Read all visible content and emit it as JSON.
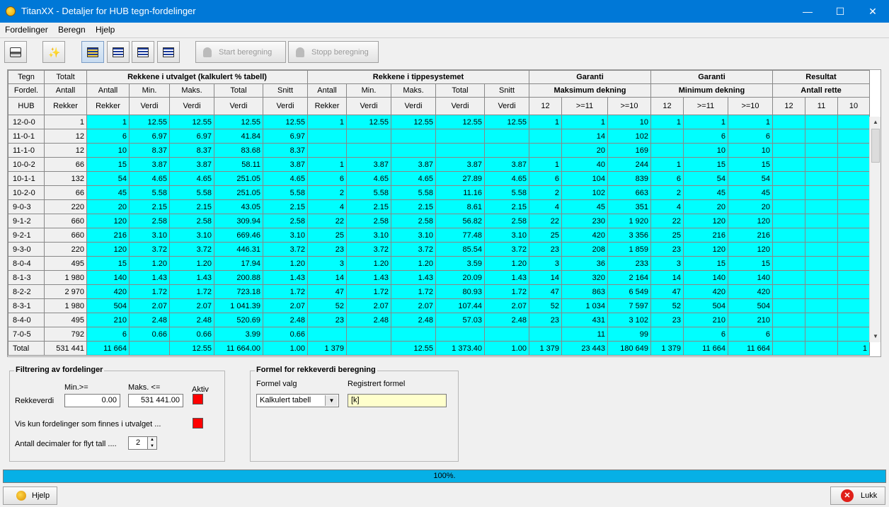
{
  "window": {
    "title": "TitanXX - Detaljer for HUB tegn-fordelinger"
  },
  "menu": [
    "Fordelinger",
    "Beregn",
    "Hjelp"
  ],
  "toolbar": {
    "start_label": "Start beregning",
    "stop_label": "Stopp beregning"
  },
  "grid": {
    "group_headers": [
      "Tegn",
      "Totalt",
      "Rekkene i utvalget (kalkulert % tabell)",
      "Rekkene i tippesystemet",
      "Garanti",
      "Garanti",
      "Resultat"
    ],
    "sub_headers": [
      "Fordel.",
      "Antall",
      "Antall",
      "Min.",
      "Maks.",
      "Total",
      "Snitt",
      "Antall",
      "Min.",
      "Maks.",
      "Total",
      "Snitt",
      "Maksimum dekning",
      "Minimum dekning",
      "Antall rette"
    ],
    "col_headers": [
      "HUB",
      "Rekker",
      "Rekker",
      "Verdi",
      "Verdi",
      "Verdi",
      "Verdi",
      "Rekker",
      "Verdi",
      "Verdi",
      "Verdi",
      "Verdi",
      "12",
      ">=11",
      ">=10",
      "12",
      ">=11",
      ">=10",
      "12",
      "11",
      "10"
    ],
    "rows": [
      [
        "12-0-0",
        "1",
        "1",
        "12.55",
        "12.55",
        "12.55",
        "12.55",
        "1",
        "12.55",
        "12.55",
        "12.55",
        "12.55",
        "1",
        "1",
        "10",
        "1",
        "1",
        "1",
        "",
        "",
        ""
      ],
      [
        "11-0-1",
        "12",
        "6",
        "6.97",
        "6.97",
        "41.84",
        "6.97",
        "",
        "",
        "",
        "",
        "",
        "",
        "14",
        "102",
        "",
        "6",
        "6",
        "",
        "",
        ""
      ],
      [
        "11-1-0",
        "12",
        "10",
        "8.37",
        "8.37",
        "83.68",
        "8.37",
        "",
        "",
        "",
        "",
        "",
        "",
        "20",
        "169",
        "",
        "10",
        "10",
        "",
        "",
        ""
      ],
      [
        "10-0-2",
        "66",
        "15",
        "3.87",
        "3.87",
        "58.11",
        "3.87",
        "1",
        "3.87",
        "3.87",
        "3.87",
        "3.87",
        "1",
        "40",
        "244",
        "1",
        "15",
        "15",
        "",
        "",
        ""
      ],
      [
        "10-1-1",
        "132",
        "54",
        "4.65",
        "4.65",
        "251.05",
        "4.65",
        "6",
        "4.65",
        "4.65",
        "27.89",
        "4.65",
        "6",
        "104",
        "839",
        "6",
        "54",
        "54",
        "",
        "",
        ""
      ],
      [
        "10-2-0",
        "66",
        "45",
        "5.58",
        "5.58",
        "251.05",
        "5.58",
        "2",
        "5.58",
        "5.58",
        "11.16",
        "5.58",
        "2",
        "102",
        "663",
        "2",
        "45",
        "45",
        "",
        "",
        ""
      ],
      [
        "9-0-3",
        "220",
        "20",
        "2.15",
        "2.15",
        "43.05",
        "2.15",
        "4",
        "2.15",
        "2.15",
        "8.61",
        "2.15",
        "4",
        "45",
        "351",
        "4",
        "20",
        "20",
        "",
        "",
        ""
      ],
      [
        "9-1-2",
        "660",
        "120",
        "2.58",
        "2.58",
        "309.94",
        "2.58",
        "22",
        "2.58",
        "2.58",
        "56.82",
        "2.58",
        "22",
        "230",
        "1 920",
        "22",
        "120",
        "120",
        "",
        "",
        ""
      ],
      [
        "9-2-1",
        "660",
        "216",
        "3.10",
        "3.10",
        "669.46",
        "3.10",
        "25",
        "3.10",
        "3.10",
        "77.48",
        "3.10",
        "25",
        "420",
        "3 356",
        "25",
        "216",
        "216",
        "",
        "",
        ""
      ],
      [
        "9-3-0",
        "220",
        "120",
        "3.72",
        "3.72",
        "446.31",
        "3.72",
        "23",
        "3.72",
        "3.72",
        "85.54",
        "3.72",
        "23",
        "208",
        "1 859",
        "23",
        "120",
        "120",
        "",
        "",
        ""
      ],
      [
        "8-0-4",
        "495",
        "15",
        "1.20",
        "1.20",
        "17.94",
        "1.20",
        "3",
        "1.20",
        "1.20",
        "3.59",
        "1.20",
        "3",
        "36",
        "233",
        "3",
        "15",
        "15",
        "",
        "",
        ""
      ],
      [
        "8-1-3",
        "1 980",
        "140",
        "1.43",
        "1.43",
        "200.88",
        "1.43",
        "14",
        "1.43",
        "1.43",
        "20.09",
        "1.43",
        "14",
        "320",
        "2 164",
        "14",
        "140",
        "140",
        "",
        "",
        ""
      ],
      [
        "8-2-2",
        "2 970",
        "420",
        "1.72",
        "1.72",
        "723.18",
        "1.72",
        "47",
        "1.72",
        "1.72",
        "80.93",
        "1.72",
        "47",
        "863",
        "6 549",
        "47",
        "420",
        "420",
        "",
        "",
        ""
      ],
      [
        "8-3-1",
        "1 980",
        "504",
        "2.07",
        "2.07",
        "1 041.39",
        "2.07",
        "52",
        "2.07",
        "2.07",
        "107.44",
        "2.07",
        "52",
        "1 034",
        "7 597",
        "52",
        "504",
        "504",
        "",
        "",
        ""
      ],
      [
        "8-4-0",
        "495",
        "210",
        "2.48",
        "2.48",
        "520.69",
        "2.48",
        "23",
        "2.48",
        "2.48",
        "57.03",
        "2.48",
        "23",
        "431",
        "3 102",
        "23",
        "210",
        "210",
        "",
        "",
        ""
      ],
      [
        "7-0-5",
        "792",
        "6",
        "0.66",
        "0.66",
        "3.99",
        "0.66",
        "",
        "",
        "",
        "",
        "",
        "",
        "11",
        "99",
        "",
        "6",
        "6",
        "",
        "",
        ""
      ]
    ],
    "total_row": [
      "Total",
      "531 441",
      "11 664",
      "",
      "12.55",
      "11 664.00",
      "1.00",
      "1 379",
      "",
      "12.55",
      "1 373.40",
      "1.00",
      "1 379",
      "23 443",
      "180 649",
      "1 379",
      "11 664",
      "11 664",
      "",
      "",
      "1"
    ]
  },
  "filter": {
    "legend": "Filtrering av fordelinger",
    "min_label": "Min.>=",
    "max_label": "Maks. <=",
    "aktiv_label": "Aktiv",
    "rekkeverdi_label": "Rekkeverdi",
    "min_value": "0.00",
    "max_value": "531 441.00",
    "vis_kun_label": "Vis kun fordelinger som finnes i utvalget ...",
    "decimals_label": "Antall decimaler for flyt tall ....",
    "decimals_value": "2"
  },
  "formula": {
    "legend": "Formel for rekkeverdi beregning",
    "valg_label": "Formel valg",
    "reg_label": "Registrert formel",
    "select_value": "Kalkulert tabell",
    "formula_value": "[k]"
  },
  "progress": {
    "text": "100%."
  },
  "buttons": {
    "help": "Hjelp",
    "close": "Lukk"
  },
  "colors": {
    "cell_bg": "#00ffff",
    "title_bar": "#0078d7",
    "progress": "#06b0e6",
    "active_toggle": "#ff0000"
  }
}
